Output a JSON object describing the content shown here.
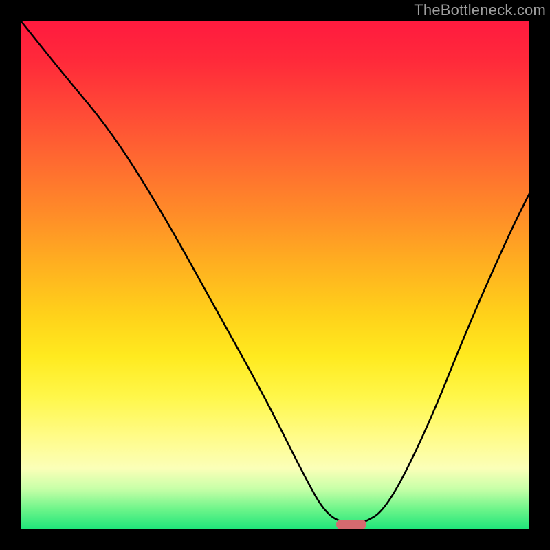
{
  "watermark": "TheBottleneck.com",
  "chart_data": {
    "type": "line",
    "title": "",
    "xlabel": "",
    "ylabel": "",
    "xlim": [
      0,
      100
    ],
    "ylim": [
      0,
      100
    ],
    "series": [
      {
        "name": "bottleneck-curve",
        "x": [
          0,
          8,
          18,
          28,
          38,
          48,
          56,
          60,
          64,
          67,
          72,
          80,
          88,
          96,
          100
        ],
        "values": [
          100,
          90,
          78,
          62,
          44,
          26,
          10,
          3,
          1,
          1,
          4,
          20,
          40,
          58,
          66
        ]
      }
    ],
    "marker": {
      "x_start": 62,
      "x_end": 68,
      "y": 0.5
    },
    "background_gradient": {
      "top": "#ff1a3f",
      "mid": "#ffd21a",
      "bottom": "#1de57a"
    },
    "legend": null,
    "grid": false
  }
}
